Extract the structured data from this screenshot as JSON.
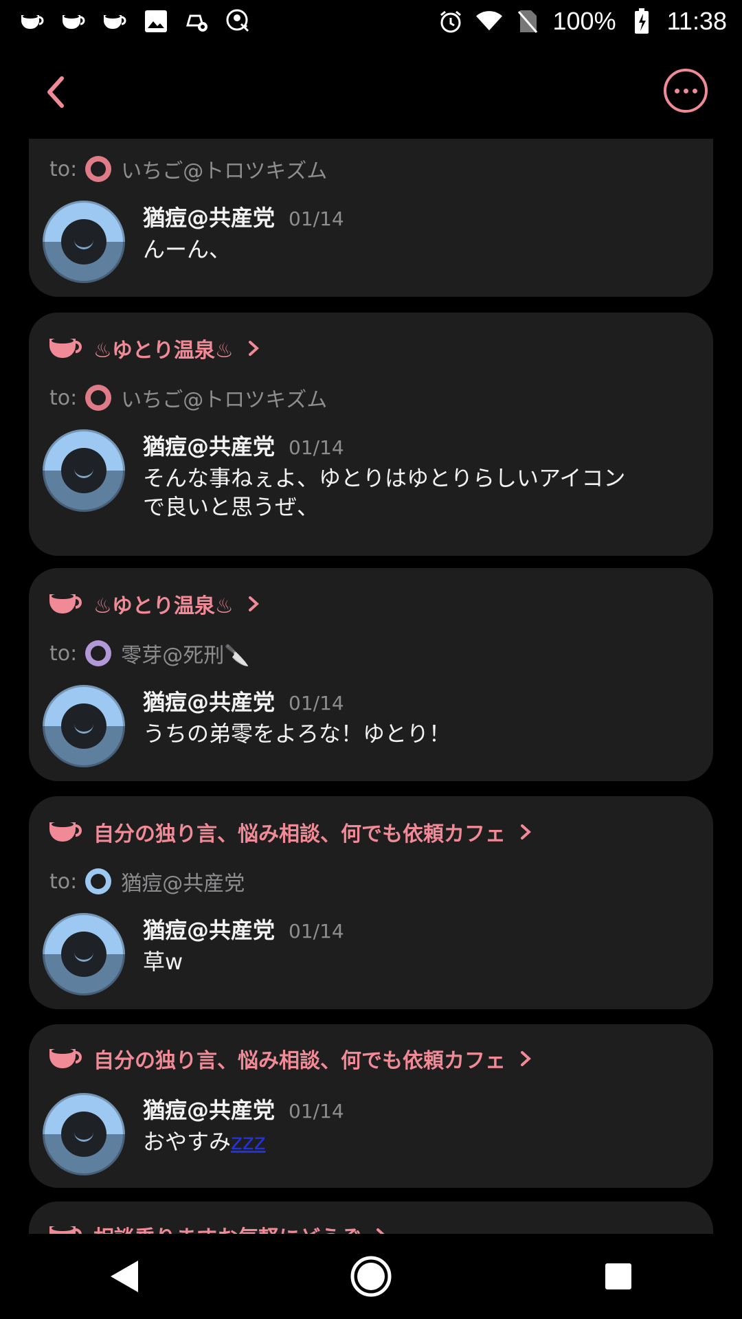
{
  "status_bar": {
    "battery": "100%",
    "time": "11:38",
    "left_icons": [
      "cup-icon",
      "cup-icon",
      "cup-icon",
      "image-icon",
      "settings-bag-icon",
      "account-key-icon"
    ],
    "right_icons": [
      "alarm-icon",
      "wifi-icon",
      "no-sim-icon",
      "battery-charging-icon"
    ]
  },
  "header": {
    "back_icon": "chevron-left-icon",
    "more_icon": "more-horizontal-icon"
  },
  "colors": {
    "accent": "#f08a96",
    "card": "#1e1e1f",
    "muted": "#8e8e90"
  },
  "posts": [
    {
      "cafe": "",
      "to_prefix": "to:",
      "to_name": "いちご@トロツキズム",
      "author": "猶痘@共産党",
      "date": "01/14",
      "text": "んーん、"
    },
    {
      "cafe": "♨ゆとり温泉♨",
      "to_prefix": "to:",
      "to_name": "いちご@トロツキズム",
      "author": "猶痘@共産党",
      "date": "01/14",
      "text_line1": "そんな事ねぇよ、ゆとりはゆとりらしいアイコン",
      "text_line2": "で良いと思うぜ、"
    },
    {
      "cafe": "♨ゆとり温泉♨",
      "to_prefix": "to:",
      "to_name": "零芽@死刑🔪",
      "author": "猶痘@共産党",
      "date": "01/14",
      "text": "うちの弟零をよろな！ゆとり！"
    },
    {
      "cafe": "自分の独り言、悩み相談、何でも依頼カフェ",
      "to_prefix": "to:",
      "to_name": "猶痘@共産党",
      "author": "猶痘@共産党",
      "date": "01/14",
      "text": "草w"
    },
    {
      "cafe": "自分の独り言、悩み相談、何でも依頼カフェ",
      "author": "猶痘@共産党",
      "date": "01/14",
      "text": "おやすみ",
      "text_link": "zzz"
    },
    {
      "cafe": "相談乗りますお気軽にどうぞ"
    }
  ],
  "nav": {
    "back": "triangle-back-icon",
    "home": "circle-home-icon",
    "recents": "square-recents-icon"
  }
}
